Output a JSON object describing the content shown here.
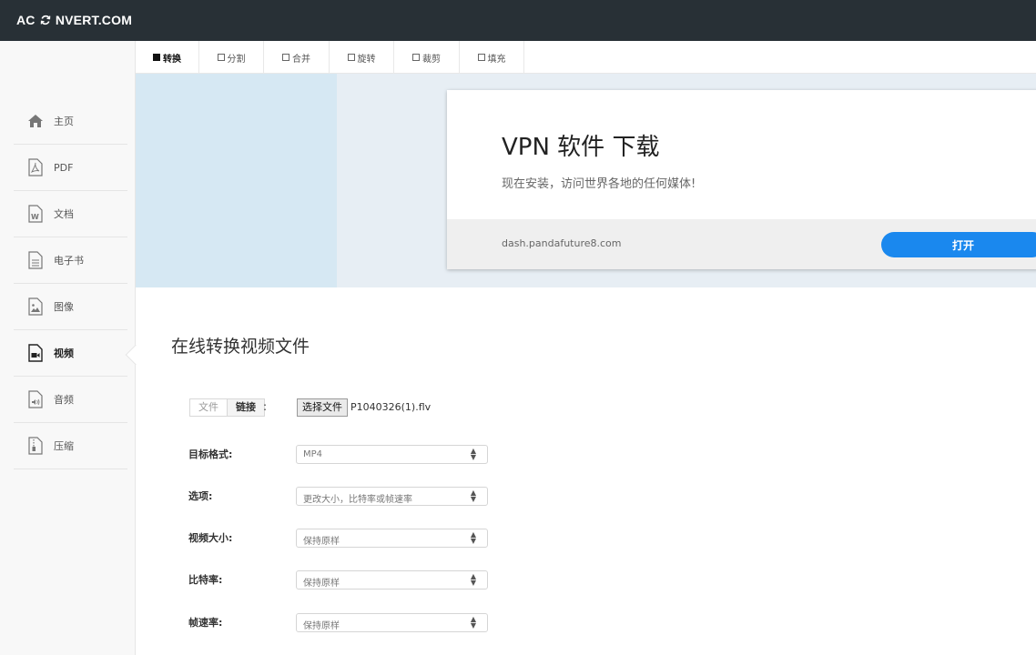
{
  "header": {
    "logo_pre": "AC",
    "logo_post": "NVERT.COM"
  },
  "tabs": [
    {
      "label": "转换",
      "active": true
    },
    {
      "label": "分割"
    },
    {
      "label": "合并"
    },
    {
      "label": "旋转"
    },
    {
      "label": "裁剪"
    },
    {
      "label": "填充"
    }
  ],
  "sidebar": {
    "items": [
      {
        "label": "主页",
        "icon": "home-icon"
      },
      {
        "label": "PDF",
        "icon": "pdf-icon"
      },
      {
        "label": "文档",
        "icon": "word-document-icon"
      },
      {
        "label": "电子书",
        "icon": "ebook-icon"
      },
      {
        "label": "图像",
        "icon": "image-icon"
      },
      {
        "label": "视频",
        "icon": "video-icon",
        "active": true
      },
      {
        "label": "音频",
        "icon": "audio-icon"
      },
      {
        "label": "压缩",
        "icon": "archive-icon"
      }
    ]
  },
  "ad": {
    "title": "VPN 软件 下载",
    "subtitle": "现在安装，访问世界各地的任何媒体!",
    "url": "dash.pandafuture8.com",
    "button": "打开",
    "button_color": "#1a88ee"
  },
  "main": {
    "title": "在线转换视频文件",
    "source_tabs": {
      "file": "文件",
      "link": "链接",
      "colon": ":"
    },
    "file_button": "选择文件",
    "file_name": "P1040326(1).flv",
    "fields": [
      {
        "label": "目标格式:",
        "value": "MP4"
      },
      {
        "label": "选项:",
        "value": "更改大小，比特率或帧速率"
      },
      {
        "label": "视频大小:",
        "value": "保持原样"
      },
      {
        "label": "比特率:",
        "value": "保持原样"
      },
      {
        "label": "帧速率:",
        "value": "保持原样"
      }
    ]
  },
  "colors": {
    "header_bg": "#283036",
    "sidebar_bg": "#f8f8f8",
    "ad_bg": "#e7eef4"
  }
}
